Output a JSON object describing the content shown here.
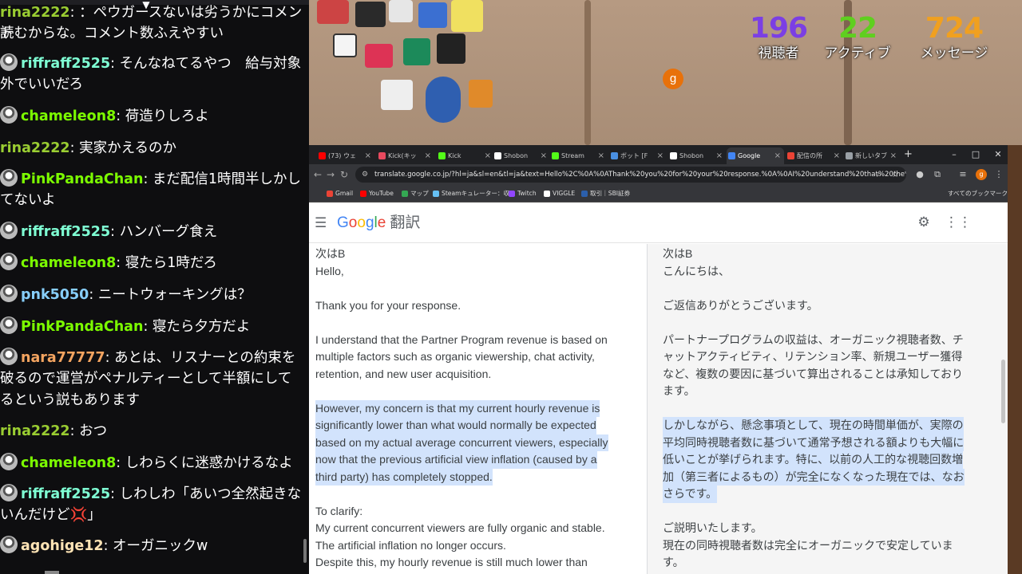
{
  "chat": {
    "messages": [
      {
        "user": "rina2222",
        "text": "：ペウガースないは劣うかにコメント",
        "color": "#9acd32",
        "avatar": false
      },
      {
        "user": "",
        "text": "読むからな。コメント数ふえやすい",
        "color": "#ffffff",
        "avatar": false
      },
      {
        "user": "riffraff2525",
        "text": "そんなねてるやつ　給与対象",
        "color": "#7fffd4",
        "avatar": true
      },
      {
        "user": "",
        "text": "外でいいだろ",
        "color": "#ffffff",
        "avatar": false
      },
      {
        "user": "chameleon8",
        "text": "荷造りしろよ",
        "color": "#7cfc00",
        "avatar": true
      },
      {
        "user": "rina2222",
        "text": "実家かえるのか",
        "color": "#9acd32",
        "avatar": false
      },
      {
        "user": "PinkPandaChan",
        "text": "まだ配信1時間半しかし",
        "color": "#7cfc00",
        "avatar": true
      },
      {
        "user": "",
        "text": "てないよ",
        "color": "#ffffff",
        "avatar": false
      },
      {
        "user": "riffraff2525",
        "text": "ハンバーグ食え",
        "color": "#7fffd4",
        "avatar": true
      },
      {
        "user": "chameleon8",
        "text": "寝たら1時だろ",
        "color": "#7cfc00",
        "avatar": true
      },
      {
        "user": "pnk5050",
        "text": "ニートウォーキングは？",
        "color": "#87cefa",
        "avatar": true
      },
      {
        "user": "PinkPandaChan",
        "text": "寝たら夕方だよ",
        "color": "#7cfc00",
        "avatar": true
      },
      {
        "user": "nara77777",
        "text": "あとは、リスナーとの約束を",
        "color": "#f4a460",
        "avatar": true
      },
      {
        "user": "",
        "text": "破るので運営がペナルティーとして半額にして",
        "color": "#ffffff",
        "avatar": false
      },
      {
        "user": "",
        "text": "るという説もあります",
        "color": "#ffffff",
        "avatar": false
      },
      {
        "user": "rina2222",
        "text": "おつ",
        "color": "#9acd32",
        "avatar": false
      },
      {
        "user": "chameleon8",
        "text": "しわらくに迷惑かけるなよ",
        "color": "#7cfc00",
        "avatar": true
      },
      {
        "user": "riffraff2525",
        "text": "しわしわ「あいつ全然起きな",
        "color": "#7fffd4",
        "avatar": true
      },
      {
        "user": "",
        "text": "いんだけど💢」",
        "color": "#ffffff",
        "avatar": false
      },
      {
        "user": "agohige12",
        "text": "オーガニックw",
        "color": "#ffe4b5",
        "avatar": true
      }
    ]
  },
  "stats": {
    "viewers": {
      "value": "196",
      "label": "視聴者",
      "color": "#7b3fe4"
    },
    "active": {
      "value": "22",
      "label": "アクティブ",
      "color": "#5fcf1f"
    },
    "messages": {
      "value": "724",
      "label": "メッセージ",
      "color": "#f0a020"
    }
  },
  "browser": {
    "tabs": [
      {
        "label": "(73) ウェ",
        "icon_color": "#ff0000"
      },
      {
        "label": "Kick(キッ",
        "icon_color": "#e84a5f"
      },
      {
        "label": "Kick",
        "icon_color": "#53fc18"
      },
      {
        "label": "Shobon",
        "icon_color": "#ffffff"
      },
      {
        "label": "Stream",
        "icon_color": "#53fc18"
      },
      {
        "label": "ボット [F",
        "icon_color": "#4a90e2"
      },
      {
        "label": "Shobon",
        "icon_color": "#ffffff"
      },
      {
        "label": "Google",
        "icon_color": "#4285f4"
      },
      {
        "label": "配信の所",
        "icon_color": "#ea4335"
      },
      {
        "label": "新しいタブ",
        "icon_color": "#9aa0a6"
      }
    ],
    "new_tab": "+",
    "window_controls": {
      "minimize": "–",
      "maximize": "□",
      "close": "✕"
    },
    "url": "translate.google.co.jp/?hl=ja&sl=en&tl=ja&text=Hello%2C%0A%0AThank%20you%20for%20your%20response.%0A%0AI%20understand%20that%20the%20Par...",
    "bookmarks": [
      {
        "label": "Gmail",
        "icon_color": "#ea4335"
      },
      {
        "label": "YouTube",
        "icon_color": "#ff0000"
      },
      {
        "label": "マップ",
        "icon_color": "#34a853"
      },
      {
        "label": "Steamキュレーター：収...",
        "icon_color": "#66c0f4"
      },
      {
        "label": "Twitch",
        "icon_color": "#9146ff"
      },
      {
        "label": "VIGGLE",
        "icon_color": "#ffffff"
      },
      {
        "label": "取引｜SBI証券",
        "icon_color": "#2b5fab"
      }
    ],
    "all_bookmarks": "すべてのブックマーク",
    "profile_initial": "g"
  },
  "translate": {
    "logo": {
      "g1": "G",
      "g2": "o",
      "g3": "o",
      "g4": "g",
      "g5": "l",
      "g6": "e",
      "product": "翻訳"
    },
    "avatar_initial": "g",
    "source_lines": [
      {
        "text": "次はB",
        "hl": false
      },
      {
        "text": "Hello,",
        "hl": false
      },
      {
        "text": "",
        "hl": false
      },
      {
        "text": "Thank you for your response.",
        "hl": false
      },
      {
        "text": "",
        "hl": false
      },
      {
        "text": "I understand that the Partner Program revenue is based on",
        "hl": false
      },
      {
        "text": "multiple factors such as organic viewership, chat activity,",
        "hl": false
      },
      {
        "text": "retention, and new user acquisition.",
        "hl": false
      },
      {
        "text": "",
        "hl": false
      },
      {
        "text": "However, my concern is that my current hourly revenue is",
        "hl": true
      },
      {
        "text": "significantly lower than what would normally be expected",
        "hl": true
      },
      {
        "text": "based on my actual average concurrent viewers, especially",
        "hl": true
      },
      {
        "text": "now that the previous artificial view inflation (caused by a",
        "hl": true
      },
      {
        "text": "third party) has completely stopped.",
        "hl": true
      },
      {
        "text": "",
        "hl": false
      },
      {
        "text": "To clarify:",
        "hl": false
      },
      {
        "text": "My current concurrent viewers are fully organic and stable.",
        "hl": false
      },
      {
        "text": "The artificial inflation no longer occurs.",
        "hl": false
      },
      {
        "text": "Despite this, my hourly revenue is still much lower than",
        "hl": false
      }
    ],
    "target_lines": [
      {
        "text": "次はB",
        "hl": false
      },
      {
        "text": "こんにちは、",
        "hl": false
      },
      {
        "text": "",
        "hl": false
      },
      {
        "text": "ご返信ありがとうございます。",
        "hl": false
      },
      {
        "text": "",
        "hl": false
      },
      {
        "text": "パートナープログラムの収益は、オーガニック視聴者数、チ",
        "hl": false
      },
      {
        "text": "ャットアクティビティ、リテンション率、新規ユーザー獲得",
        "hl": false
      },
      {
        "text": "など、複数の要因に基づいて算出されることは承知しており",
        "hl": false
      },
      {
        "text": "ます。",
        "hl": false
      },
      {
        "text": "",
        "hl": false
      },
      {
        "text": "しかしながら、懸念事項として、現在の時間単価が、実際の",
        "hl": true
      },
      {
        "text": "平均同時視聴者数に基づいて通常予想される額よりも大幅に",
        "hl": true
      },
      {
        "text": "低いことが挙げられます。特に、以前の人工的な視聴回数増",
        "hl": true
      },
      {
        "text": "加（第三者によるもの）が完全になくなった現在では、なお",
        "hl": true
      },
      {
        "text": "さらです。",
        "hl": true
      },
      {
        "text": "",
        "hl": false
      },
      {
        "text": "ご説明いたします。",
        "hl": false
      },
      {
        "text": "現在の同時視聴者数は完全にオーガニックで安定していま",
        "hl": false
      },
      {
        "text": "す。",
        "hl": false
      }
    ]
  }
}
